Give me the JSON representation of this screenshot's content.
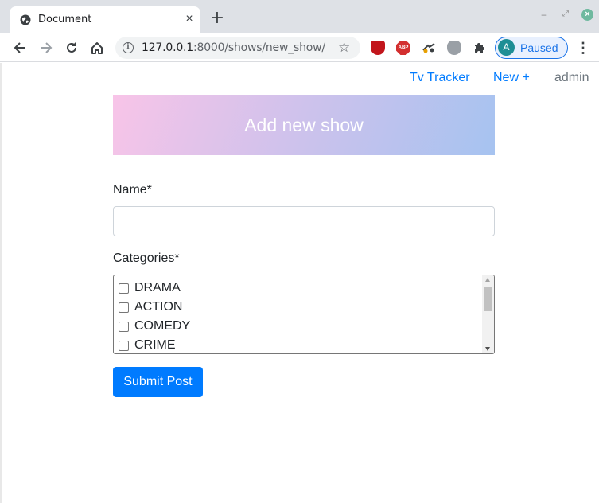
{
  "browser": {
    "tab_title": "Document",
    "url_host": "127.0.0.1",
    "url_rest": ":8000/shows/new_show/",
    "profile_initial": "A",
    "profile_status": "Paused",
    "ext_abp_label": "ABP"
  },
  "nav": {
    "brand": "Tv Tracker",
    "new_link": "New +",
    "user": "admin"
  },
  "banner": {
    "title": "Add new show"
  },
  "form": {
    "name_label": "Name*",
    "name_value": "",
    "categories_label": "Categories*",
    "categories": [
      {
        "label": "DRAMA",
        "checked": false
      },
      {
        "label": "ACTION",
        "checked": false
      },
      {
        "label": "COMEDY",
        "checked": false
      },
      {
        "label": "CRIME",
        "checked": false
      }
    ],
    "submit_label": "Submit Post"
  },
  "colors": {
    "link": "#007bff",
    "muted": "#6c757d",
    "button": "#007bff",
    "banner_start": "#f8c4e8",
    "banner_end": "#a6c3f0"
  }
}
